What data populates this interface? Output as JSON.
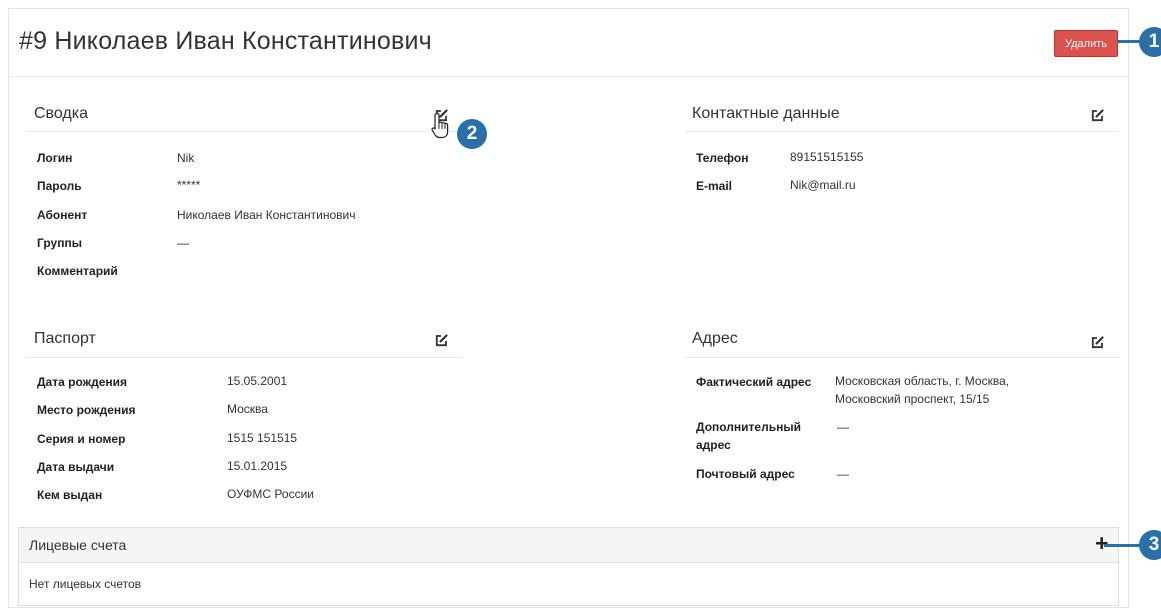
{
  "header": {
    "title": "#9 Николаев Иван Константинович",
    "delete_label": "Удалить"
  },
  "summary": {
    "title": "Сводка",
    "rows": [
      {
        "label": "Логин",
        "value": "Nik"
      },
      {
        "label": "Пароль",
        "value": "*****"
      },
      {
        "label": "Абонент",
        "value": "Николаев Иван Константинович"
      },
      {
        "label": "Группы",
        "value": "—"
      },
      {
        "label": "Комментарий",
        "value": ""
      }
    ]
  },
  "contacts": {
    "title": "Контактные данные",
    "rows": [
      {
        "label": "Телефон",
        "value": "89151515155"
      },
      {
        "label": "E-mail",
        "value": "Nik@mail.ru"
      }
    ]
  },
  "passport": {
    "title": "Паспорт",
    "rows": [
      {
        "label": "Дата рождения",
        "value": "15.05.2001"
      },
      {
        "label": "Место рождения",
        "value": "Москва"
      },
      {
        "label": "Серия и номер",
        "value": "1515 151515"
      },
      {
        "label": "Дата выдачи",
        "value": "15.01.2015"
      },
      {
        "label": "Кем выдан",
        "value": "ОУФМС России"
      }
    ]
  },
  "address": {
    "title": "Адрес",
    "actual_label": "Фактический адрес",
    "actual_value_line1": "Московская область, г. Москва,",
    "actual_value_line2": "Московский проспект, 15/15",
    "additional_label_line1": "Дополнительный",
    "additional_label_line2": "адрес",
    "additional_value": "—",
    "postal_label": "Почтовый адрес",
    "postal_value": "—"
  },
  "accounts": {
    "title": "Лицевые счета",
    "add_icon": "+",
    "empty_text": "Нет лицевых счетов"
  },
  "callouts": {
    "one": "1",
    "two": "2",
    "three": "3",
    "color": "#2a6fa8"
  },
  "colors": {
    "danger": "#d9534f",
    "panel_header": "#f5f5f5"
  }
}
